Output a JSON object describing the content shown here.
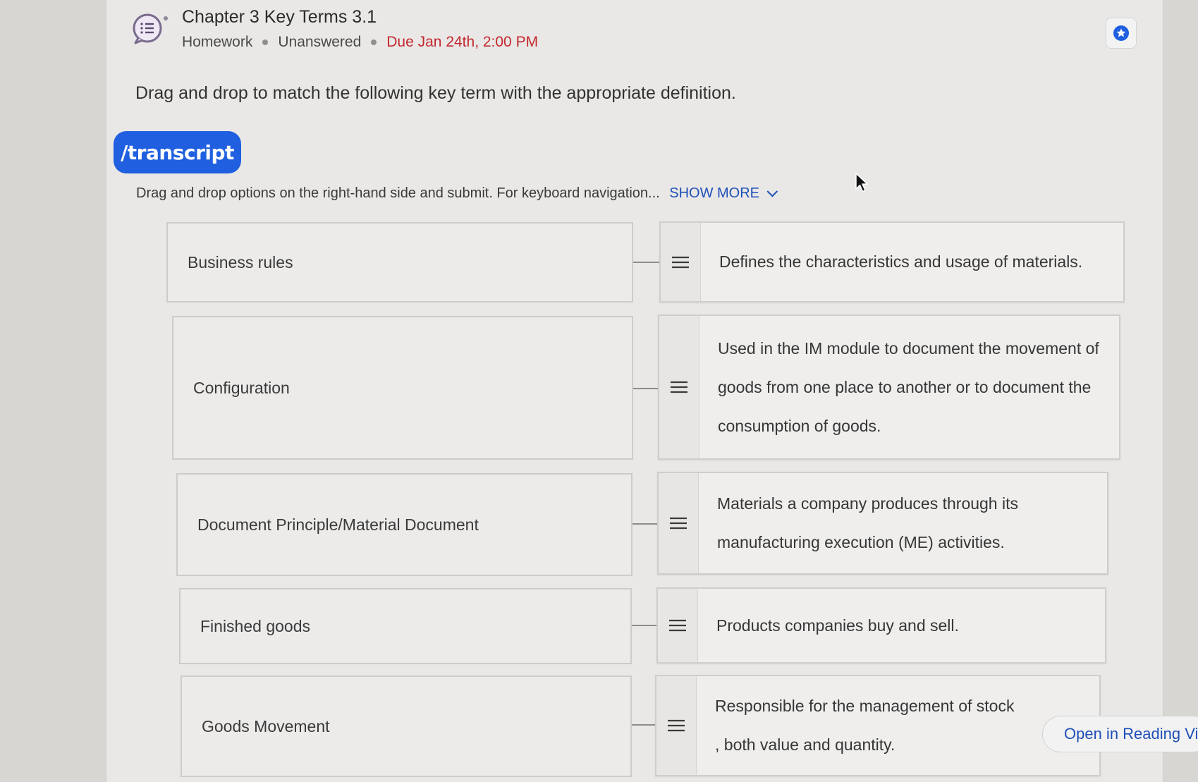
{
  "header": {
    "title": "Chapter 3 Key Terms 3.1",
    "type": "Homework",
    "status": "Unanswered",
    "due": "Due Jan 24th, 2:00 PM"
  },
  "question": {
    "prompt": "Drag and drop to match the following key term with the appropriate definition.",
    "brand": "/transcript",
    "instructions": "Drag and drop options on the right-hand side and submit. For keyboard navigation...",
    "show_more": "SHOW MORE"
  },
  "pairs": [
    {
      "term": "Business rules",
      "definition": "Defines the characteristics and usage of materials."
    },
    {
      "term": "Configuration",
      "definition": "Used in the IM module to document the movement of goods from one place to another or to document the consumption of goods."
    },
    {
      "term": "Document Principle/Material Document",
      "definition": "Materials a company produces through its manufacturing execution (ME) activities."
    },
    {
      "term": "Finished goods",
      "definition": "Products companies buy and sell."
    },
    {
      "term": "Goods Movement",
      "definition": "Responsible for the management of stock , both value and quantity."
    }
  ],
  "footer": {
    "open_reading": "Open in Reading View"
  },
  "icons": {
    "question": "chat-list-icon",
    "bookmark": "star-icon",
    "drag": "drag-handle-icon",
    "expand": "expand-arrows-icon"
  },
  "colors": {
    "accent": "#1f5fe0",
    "due": "#c3272e",
    "link": "#1f4fb8"
  }
}
